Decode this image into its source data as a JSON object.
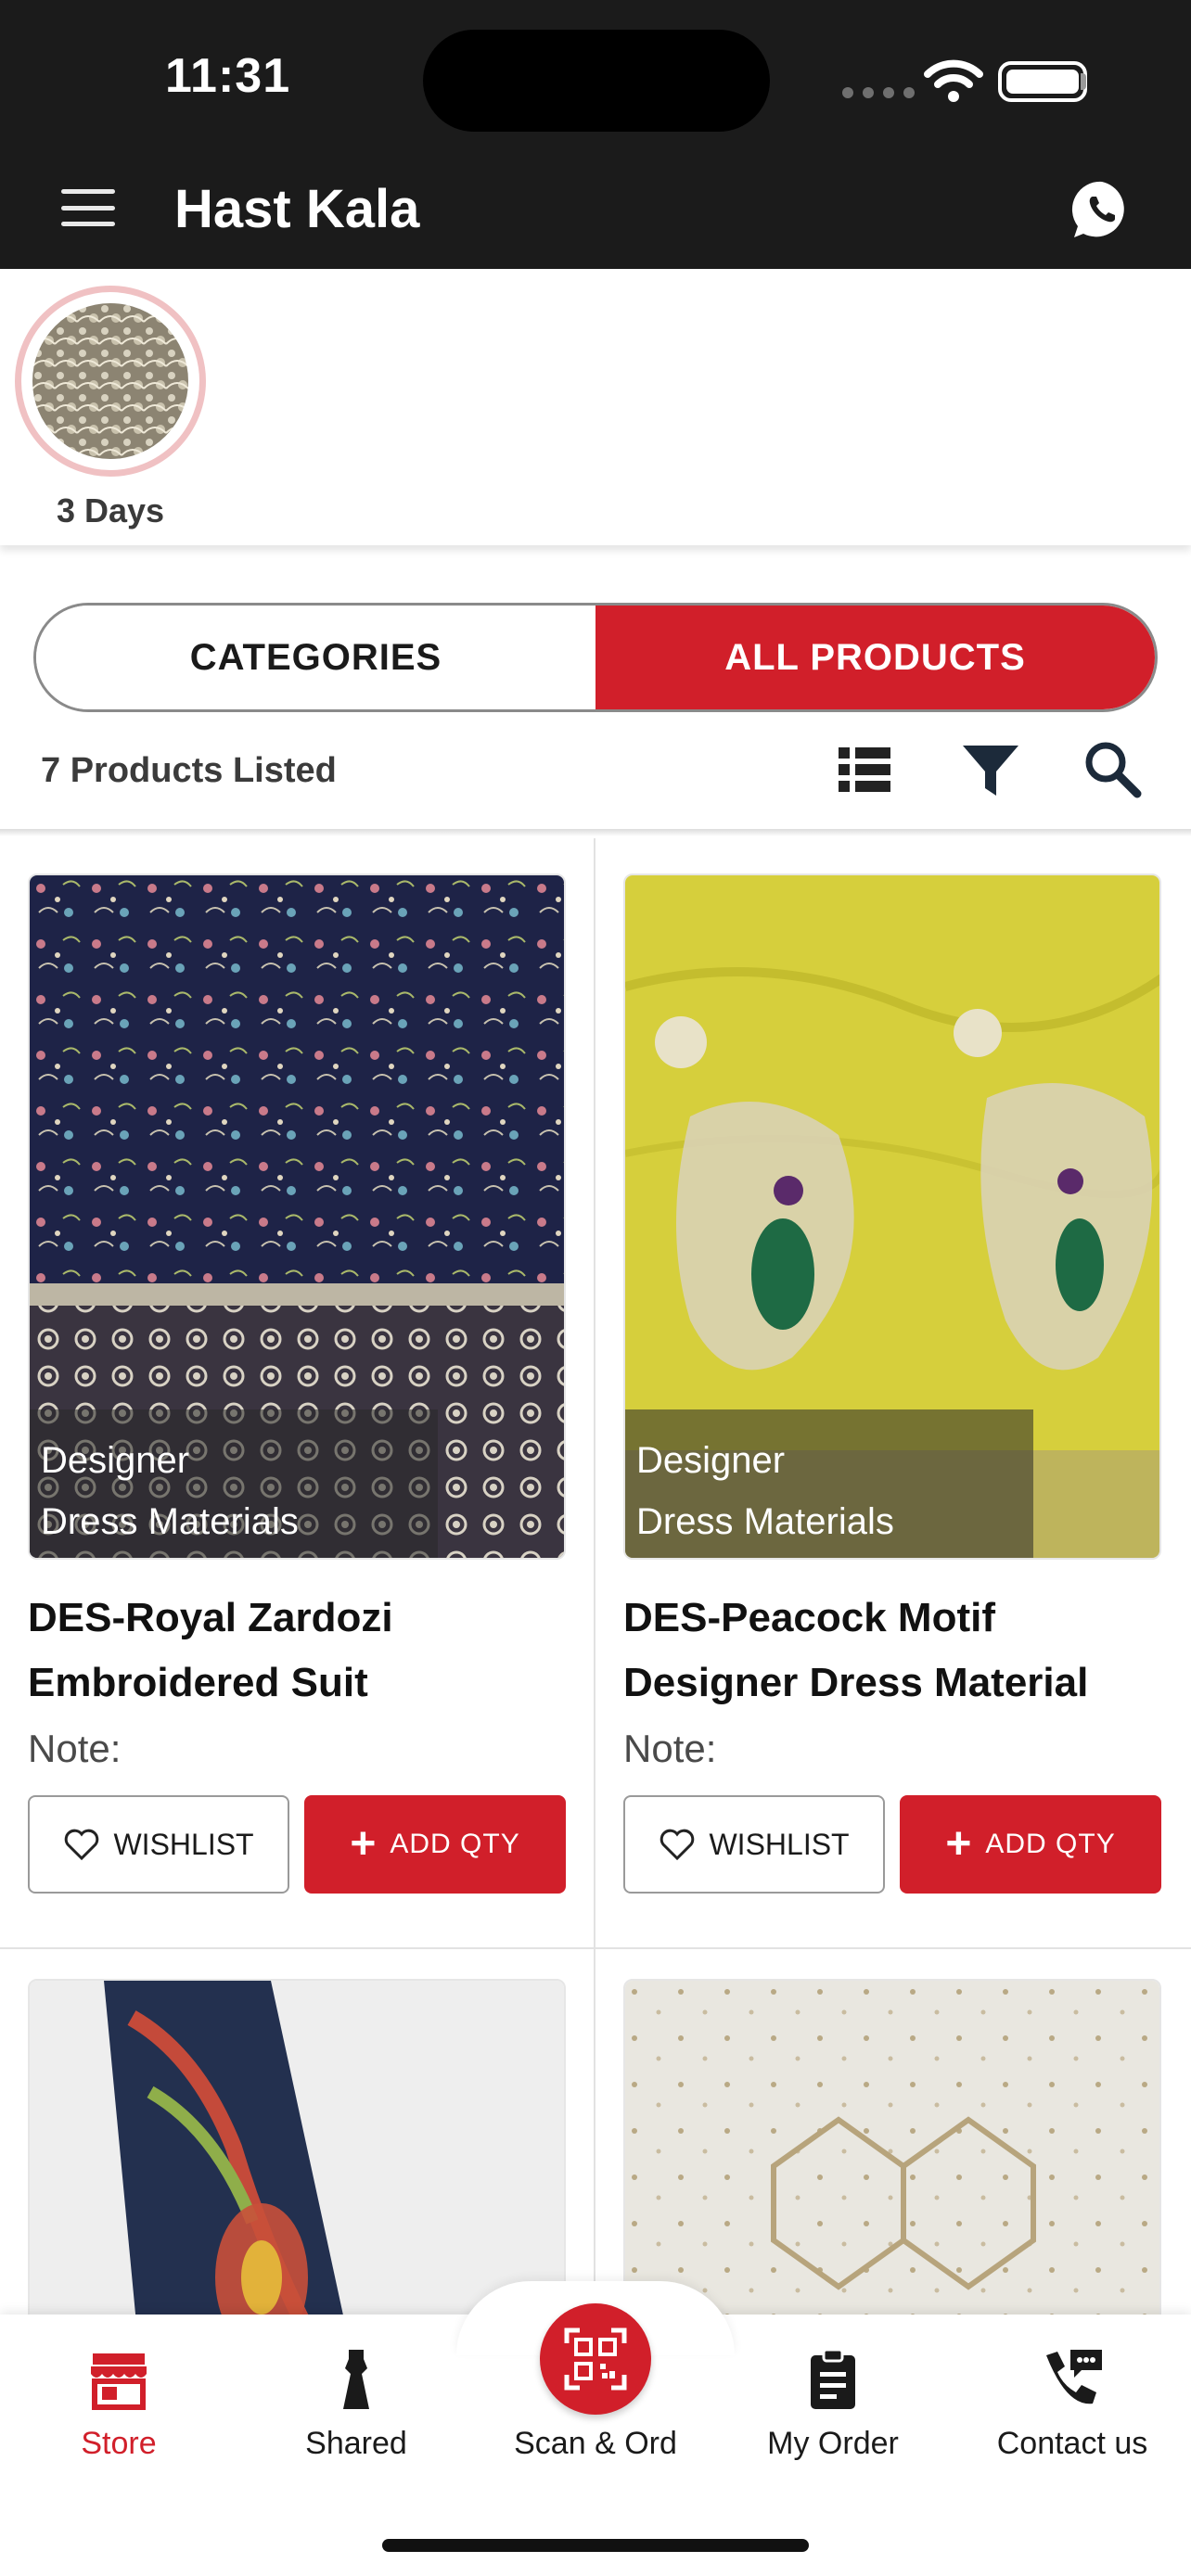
{
  "status_bar": {
    "time": "11:31"
  },
  "header": {
    "title": "Hast Kala"
  },
  "stories": [
    {
      "label": "3 Days"
    }
  ],
  "toggle": {
    "categories": "CATEGORIES",
    "all_products": "ALL PRODUCTS",
    "active": "all_products"
  },
  "listing": {
    "count_text": "7 Products Listed"
  },
  "products": [
    {
      "category_line1": "Designer",
      "category_line2": "Dress Materials",
      "title": "DES-Royal Zardozi Embroidered Suit",
      "note": "Note:",
      "wishlist": "WISHLIST",
      "add_qty": "ADD QTY"
    },
    {
      "category_line1": "Designer",
      "category_line2": "Dress Materials",
      "title": "DES-Peacock Motif Designer Dress Material",
      "note": "Note:",
      "wishlist": "WISHLIST",
      "add_qty": "ADD QTY"
    },
    {
      "category_line1": "",
      "category_line2": "",
      "title": "",
      "note": "",
      "wishlist": "",
      "add_qty": ""
    },
    {
      "category_line1": "",
      "category_line2": "",
      "title": "",
      "note": "",
      "wishlist": "",
      "add_qty": ""
    }
  ],
  "bottom_nav": [
    {
      "label": "Store",
      "icon": "store-icon",
      "active": true
    },
    {
      "label": "Shared",
      "icon": "dress-icon",
      "active": false
    },
    {
      "label": "Scan & Ord",
      "icon": "qr-scan-icon",
      "active": false
    },
    {
      "label": "My Order",
      "icon": "clipboard-icon",
      "active": false
    },
    {
      "label": "Contact us",
      "icon": "phone-chat-icon",
      "active": false
    }
  ],
  "colors": {
    "accent": "#d11f2a",
    "header_bg": "#1b1b1b",
    "story_ring": "#f0c1c3"
  }
}
